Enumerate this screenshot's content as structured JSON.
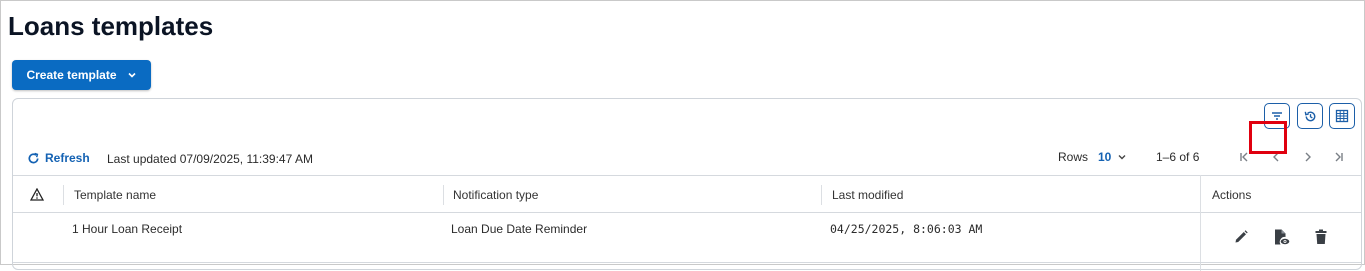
{
  "page": {
    "title": "Loans templates"
  },
  "toolbar": {
    "create_label": "Create template",
    "refresh_label": "Refresh",
    "last_updated": "Last updated 07/09/2025, 11:39:47 AM",
    "rows_label": "Rows",
    "rows_value": "10",
    "page_range": "1–6 of 6"
  },
  "table": {
    "columns": [
      {
        "key": "warning",
        "label": ""
      },
      {
        "key": "template_name",
        "label": "Template name"
      },
      {
        "key": "notification_type",
        "label": "Notification type"
      },
      {
        "key": "last_modified",
        "label": "Last modified"
      },
      {
        "key": "actions",
        "label": "Actions"
      }
    ],
    "rows": [
      {
        "template_name": "1 Hour Loan Receipt",
        "notification_type": "Loan Due Date Reminder",
        "last_modified": "04/25/2025, 8:06:03 AM"
      }
    ]
  },
  "icons": {
    "chevron": "chevron-down-icon",
    "filter": "filter-icon",
    "history": "history-icon",
    "columns": "columns-icon",
    "refresh": "refresh-icon",
    "warning": "warning-icon",
    "edit": "pencil-icon",
    "preview": "file-preview-icon",
    "delete": "trash-icon"
  },
  "colors": {
    "primary": "#0a6bc2",
    "link": "#1462b3",
    "highlight": "#e0000f"
  }
}
